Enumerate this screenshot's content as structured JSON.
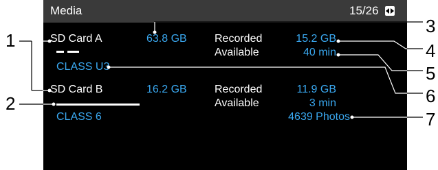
{
  "header": {
    "title": "Media",
    "page_indicator": "15/26",
    "page_icon": "page-switch-icon"
  },
  "card_a": {
    "name": "SD Card A",
    "capacity": "63.8 GB",
    "class": "CLASS U3",
    "recorded_label": "Recorded",
    "recorded_value": "15.2 GB",
    "available_label": "Available",
    "available_value": "40 min"
  },
  "card_b": {
    "name": "SD Card B",
    "capacity": "16.2 GB",
    "class": "CLASS 6",
    "recorded_label": "Recorded",
    "recorded_value": "11.9 GB",
    "available_label": "Available",
    "available_value": "3 min",
    "photos_value": "4639 Photos"
  },
  "callouts": [
    "1",
    "2",
    "3",
    "4",
    "5",
    "6",
    "7"
  ],
  "colors": {
    "value_blue": "#3aa8f0",
    "screen_bg": "#000000",
    "title_bar": "#3a3a3a"
  }
}
